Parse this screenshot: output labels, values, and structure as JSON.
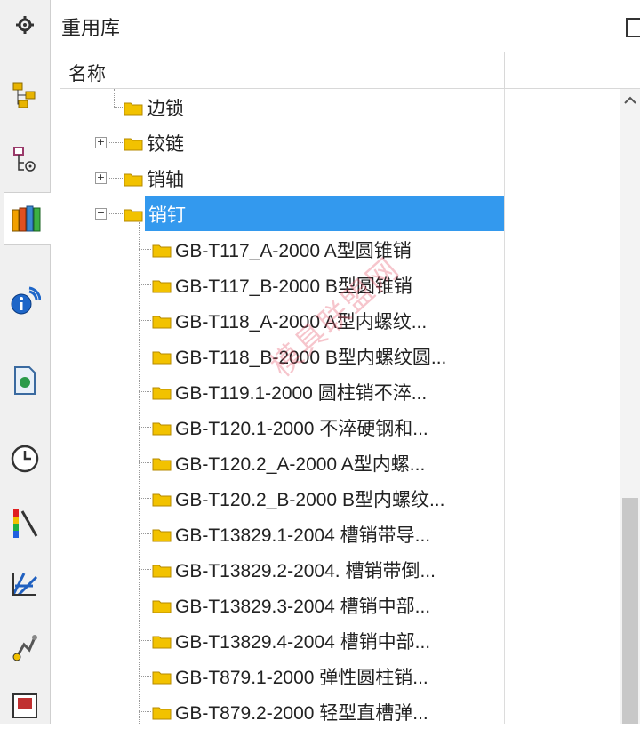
{
  "panel": {
    "title": "重用库"
  },
  "header": {
    "name_col": "名称"
  },
  "toolbar": [
    "gear-icon",
    "assembly-navigator-icon",
    "constraint-navigator-icon",
    "reuse-library-icon",
    "info-icon",
    "document-icon",
    "history-icon",
    "palette-icon",
    "roles-icon",
    "system-material-icon",
    "web-browser-icon"
  ],
  "watermark": "模具联盟网",
  "tree": {
    "parents": [
      {
        "label": "边锁",
        "expander": ""
      },
      {
        "label": "铰链",
        "expander": "+"
      },
      {
        "label": "销轴",
        "expander": "+"
      },
      {
        "label": "销钉",
        "expander": "−",
        "selected": true
      }
    ],
    "children": [
      "GB-T117_A-2000 A型圆锥销",
      "GB-T117_B-2000 B型圆锥销",
      "GB-T118_A-2000 A型内螺纹...",
      "GB-T118_B-2000 B型内螺纹圆...",
      "GB-T119.1-2000 圆柱销不淬...",
      "GB-T120.1-2000 不淬硬钢和...",
      "GB-T120.2_A-2000 A型内螺...",
      "GB-T120.2_B-2000 B型内螺纹...",
      "GB-T13829.1-2004 槽销带导...",
      "GB-T13829.2-2004. 槽销带倒...",
      "GB-T13829.3-2004 槽销中部...",
      "GB-T13829.4-2004 槽销中部...",
      "GB-T879.1-2000 弹性圆柱销...",
      "GB-T879.2-2000 轻型直槽弹..."
    ]
  },
  "colors": {
    "selection": "#3399ee",
    "folder": "#f2c200",
    "folder_edge": "#b58a00"
  }
}
